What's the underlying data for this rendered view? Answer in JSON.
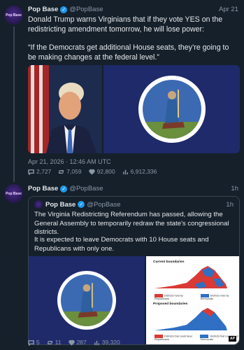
{
  "tweet1": {
    "avatar_text": "Pop Base",
    "name": "Pop Base",
    "handle": "@PopBase",
    "time": "Apr 21",
    "text_line1": "Donald Trump warns Virginians that if they vote YES on the redistricting amendment tomorrow, he will lose power:",
    "text_quote": "“If the Democrats get additional House seats, they’re going to be making changes at the federal level.”",
    "timestamp": "Apr 21, 2026 · 12:46 AM UTC",
    "stats": {
      "replies": "2,727",
      "retweets": "7,059",
      "likes": "92,800",
      "views": "6,912,336"
    }
  },
  "tweet2": {
    "avatar_text": "Pop Base",
    "name": "Pop Base",
    "handle": "@PopBase",
    "time": "1h",
    "quoted": {
      "name": "Pop Base",
      "handle": "@PopBase",
      "time": "1h",
      "text_p1": "The Virginia Redistricting Referendum has passed, allowing the General Assembly to temporarily redraw the state's congressional districts.",
      "text_p2": "It is expected to leave Democrats with 10 House seats and Republicans with only one.",
      "map": {
        "current_label": "Current boundaries",
        "proposed_label": "Proposed boundaries",
        "legend_rep": "Districts held by Republicans",
        "legend_dem": "Districts held by Democrats",
        "legend_rep2": "Districts that could favor Republicans",
        "legend_dem2": "Districts that could favor Democrats",
        "ap": "AP"
      }
    },
    "stats": {
      "replies": "5",
      "retweets": "11",
      "likes": "287",
      "views": "39,320"
    }
  },
  "colors": {
    "background": "#15202b",
    "accent": "#1d9bf0",
    "muted": "#8b98a5",
    "republican": "#d93a35",
    "democrat": "#2f6fc4"
  }
}
